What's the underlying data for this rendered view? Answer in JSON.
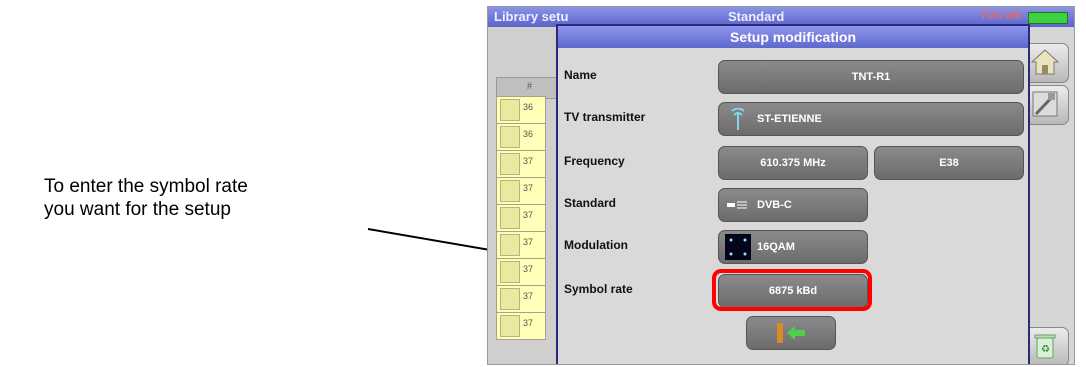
{
  "annotation": {
    "line1": "To enter the symbol rate",
    "line2": "you want for the setup"
  },
  "screen": {
    "topbar": {
      "library": "Library setu",
      "standard": "Standard",
      "status": "ТОС МК"
    },
    "list_numbers": [
      "36",
      "36",
      "37",
      "37",
      "37",
      "37",
      "37",
      "37",
      "37"
    ],
    "list_header": "#"
  },
  "dialog": {
    "title": "Setup modification",
    "fields": {
      "name": {
        "label": "Name",
        "value": "TNT-R1"
      },
      "tv_transmitter": {
        "label": "TV transmitter",
        "value": "ST-ETIENNE"
      },
      "frequency": {
        "label": "Frequency",
        "value": "610.375 MHz",
        "channel": "E38"
      },
      "standard": {
        "label": "Standard",
        "value": "DVB-C"
      },
      "modulation": {
        "label": "Modulation",
        "value": "16QAM"
      },
      "symbol_rate": {
        "label": "Symbol rate",
        "value": "6875 kBd"
      }
    }
  },
  "colors": {
    "highlight": "#ff0000",
    "title_bar": "#6a74d8",
    "field_button": "#7a7a7a"
  }
}
